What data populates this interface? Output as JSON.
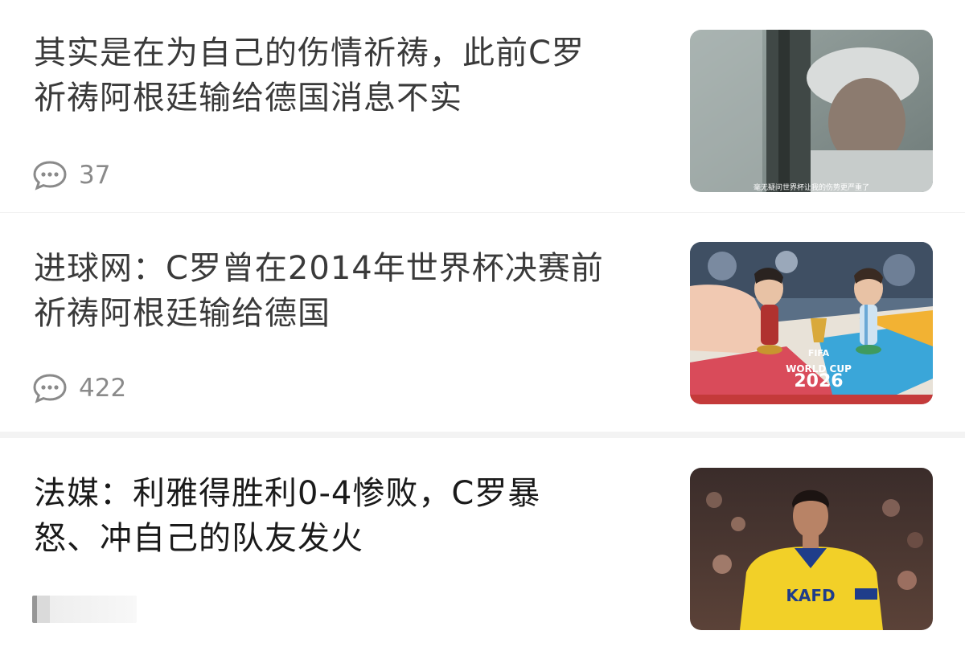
{
  "articles": [
    {
      "title_line1": "其实是在为自己的伤情祈祷，此前C罗",
      "title_line2": "祈祷阿根廷输给德国消息不实",
      "comment_count": "37",
      "thumb_caption": "毫无疑问世界杯让我的伤势更严重了"
    },
    {
      "title_line1": "进球网：C罗曾在2014年世界杯决赛前",
      "title_line2": "祈祷阿根廷输给德国",
      "comment_count": "422",
      "thumb_text_fifa": "FIFA",
      "thumb_text_wc": "WORLD CUP",
      "thumb_text_year": "2026"
    },
    {
      "title_line1": "法媒：利雅得胜利0-4惨败，C罗暴",
      "title_line2": "怒、冲自己的队友发火",
      "thumb_jersey_text": "KAFD"
    }
  ],
  "icons": {
    "comment": "comment-bubble-icon"
  },
  "colors": {
    "title": "#3a3a3a",
    "meta": "#8a8a8a",
    "separator": "#f3f3f3"
  }
}
